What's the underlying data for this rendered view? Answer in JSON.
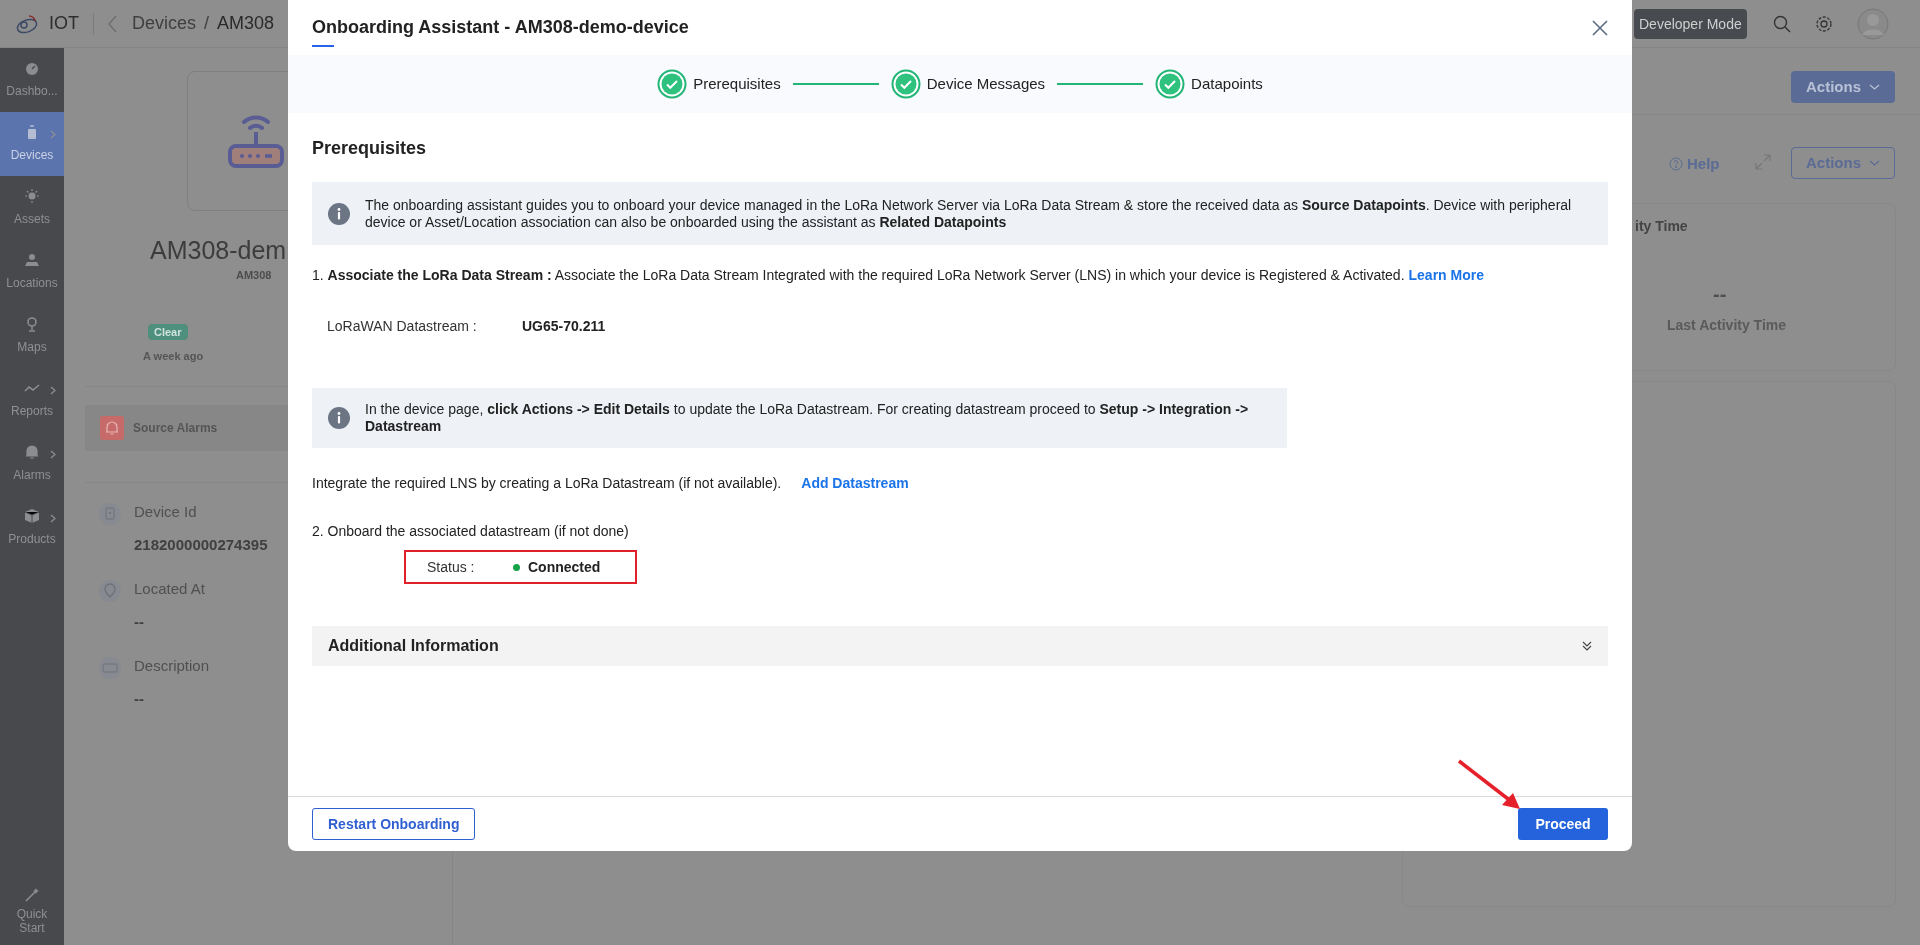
{
  "app_bar": {
    "app_name": "IOT",
    "breadcrumb": [
      "Devices",
      "AM308"
    ],
    "breadcrumb_separator": "/",
    "developer_mode_button": "Developer Mode"
  },
  "sidebar": {
    "items": [
      {
        "kind": "dashboard",
        "label": "Dashbo...",
        "selected": false,
        "has_submenu": false
      },
      {
        "kind": "devices",
        "label": "Devices",
        "selected": true,
        "has_submenu": true
      },
      {
        "kind": "assets",
        "label": "Assets",
        "selected": false,
        "has_submenu": false
      },
      {
        "kind": "locations",
        "label": "Locations",
        "selected": false,
        "has_submenu": false
      },
      {
        "kind": "maps",
        "label": "Maps",
        "selected": false,
        "has_submenu": false
      },
      {
        "kind": "reports",
        "label": "Reports",
        "selected": false,
        "has_submenu": true
      },
      {
        "kind": "alarms",
        "label": "Alarms",
        "selected": false,
        "has_submenu": true
      },
      {
        "kind": "products",
        "label": "Products",
        "selected": false,
        "has_submenu": true
      }
    ],
    "footer_item": "Quick Start"
  },
  "device_panel": {
    "name": "AM308-dem",
    "model": "AM308",
    "status_badge": "Clear",
    "status_time": "A week ago",
    "alarms_label": "Source Alarms",
    "fields": [
      {
        "kind": "id",
        "label": "Device Id",
        "value": "2182000000274395"
      },
      {
        "kind": "location",
        "label": "Located At",
        "value": "--"
      },
      {
        "kind": "description",
        "label": "Description",
        "value": "--"
      }
    ]
  },
  "right_panel": {
    "actions_primary": "Actions",
    "help_link": "Help",
    "actions_secondary": "Actions",
    "card_title": "ity Time",
    "card_value": "--",
    "card_caption": "Last Activity Time"
  },
  "modal": {
    "title": "Onboarding Assistant - AM308-demo-device",
    "steps": [
      {
        "label": "Prerequisites",
        "completed": true
      },
      {
        "label": "Device Messages",
        "completed": true
      },
      {
        "label": "Datapoints",
        "completed": true
      }
    ],
    "section_title": "Prerequisites",
    "intro_note": "The onboarding assistant guides you to onboard your device managed in the LoRa Network Server via LoRa Data Stream & store the received data as **Source Datapoints**. Device with peripheral device or Asset/Location association can also be onboarded using the assistant as **Related Datapoints**",
    "step_1": {
      "text": "1. **Associate the LoRa Data Stream :** Associate the LoRa Data Stream Integrated with the required LoRa Network Server (LNS) in which your device is Registered & Activated.",
      "link": "Learn More"
    },
    "datastream": {
      "label": "LoRaWAN Datastream :",
      "value": "UG65-70.211"
    },
    "edit_note": "In the device page, **click Actions -> Edit Details** to update the LoRa Datastream. For creating datastream proceed to **Setup -> Integration -> Datastream**",
    "integrate": {
      "text": "Integrate the required LNS by creating a LoRa Datastream (if not available).",
      "link": "Add Datastream"
    },
    "step_2": "2. Onboard the associated datastream (if not done)",
    "status": {
      "label": "Status :",
      "value": "Connected",
      "online": true
    },
    "additional_info": {
      "title": "Additional Information",
      "expanded": false
    },
    "buttons": {
      "restart": "Restart Onboarding",
      "proceed": "Proceed"
    }
  }
}
